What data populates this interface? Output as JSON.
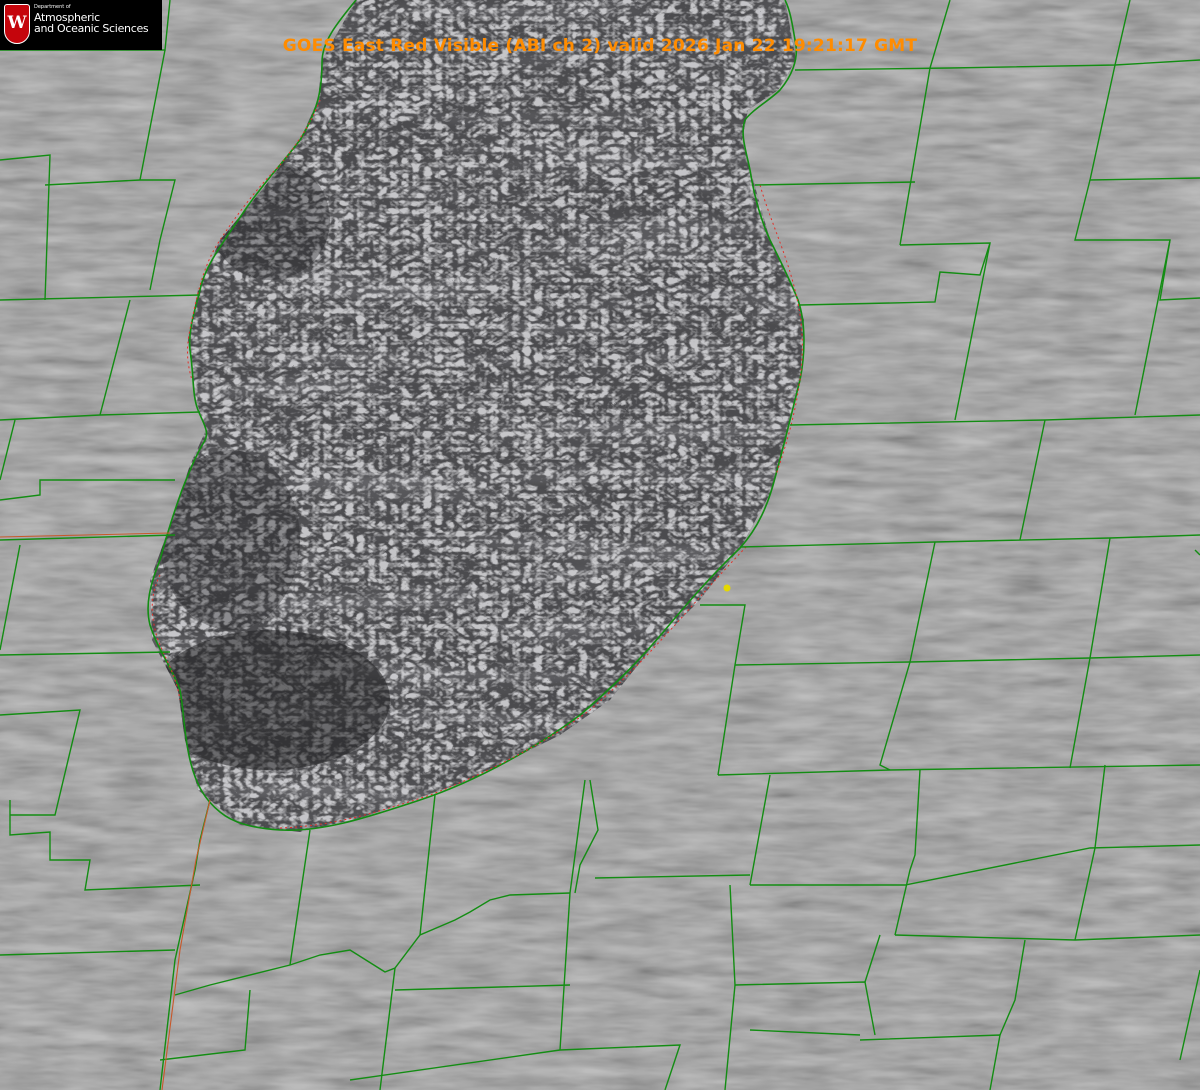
{
  "title": "GOES East Red Visible (ABI ch 2) valid 2026 Jan 22 19:21:17 GMT",
  "logo": {
    "dept": "Department of",
    "line1": "Atmospheric",
    "line2": "and Oceanic Sciences",
    "letter": "W"
  },
  "colors": {
    "title": "#ff8c00",
    "boundary": "#138d13",
    "shoreline": "#e0302a",
    "marker": "#e5d800",
    "logo_red": "#c5050c"
  }
}
